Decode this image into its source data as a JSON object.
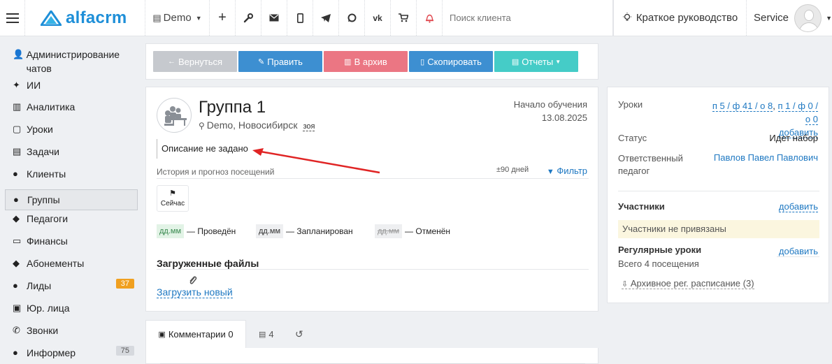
{
  "header": {
    "logo_text": "alfacrm",
    "branch": "Demo",
    "search_placeholder": "Поиск клиента",
    "guide_label": "Краткое руководство",
    "user_name": "Service",
    "icons": [
      "plus-icon",
      "wrench-icon",
      "mail-icon",
      "phone-icon",
      "telegram-icon",
      "whatsapp-icon",
      "vk-icon",
      "cart-icon",
      "bell-icon"
    ]
  },
  "sidebar": {
    "items": [
      {
        "label": "Администрирование чатов",
        "icon": "chat-admin-icon"
      },
      {
        "label": "ИИ",
        "icon": "sparkle-icon"
      },
      {
        "label": "Аналитика",
        "icon": "map-icon"
      },
      {
        "label": "Уроки",
        "icon": "calendar-icon"
      },
      {
        "label": "Задачи",
        "icon": "clipboard-icon"
      },
      {
        "label": "Клиенты",
        "icon": "user-icon"
      },
      {
        "label": "Группы",
        "icon": "users-icon"
      },
      {
        "label": "Педагоги",
        "icon": "graduation-icon"
      },
      {
        "label": "Финансы",
        "icon": "money-icon"
      },
      {
        "label": "Абонементы",
        "icon": "tag-icon"
      },
      {
        "label": "Лиды",
        "icon": "user-plus-icon",
        "badge": "37"
      },
      {
        "label": "Юр. лица",
        "icon": "briefcase-icon"
      },
      {
        "label": "Звонки",
        "icon": "phone-icon"
      },
      {
        "label": "Информер",
        "icon": "user-card-icon",
        "badge": "75"
      }
    ]
  },
  "toolbar": {
    "back": "Вернуться",
    "edit": "Править",
    "archive": "В архив",
    "copy": "Скопировать",
    "reports": "Отчеты"
  },
  "group": {
    "title": "Группа 1",
    "location": "Demo, Новосибирск",
    "tag": "зоя",
    "start_label": "Начало обучения",
    "start_date": "13.08.2025",
    "description": "Описание не задано",
    "history_label": "История и прогноз посещений",
    "history_range": "±90 дней",
    "filter": "Фильтр",
    "now_label": "Сейчас",
    "legend": [
      {
        "chip": "дд.мм",
        "label": "— Проведён"
      },
      {
        "chip": "дд.мм",
        "label": "— Запланирован"
      },
      {
        "chip": "дд.мм",
        "label": "— Отменён"
      }
    ],
    "files_title": "Загруженные файлы",
    "upload_link": "Загрузить новый"
  },
  "details": {
    "lessons_label": "Уроки",
    "lessons_line1": "п 5 / ф 41 / о 8",
    "lessons_sep": ",",
    "lessons_line1b": "п 1 / ф 0 /",
    "lessons_line2": "о 0",
    "add": "добавить",
    "status_label": "Статус",
    "status_value": "Идет набор",
    "teacher_label_1": "Ответственный",
    "teacher_label_2": "педагог",
    "teacher_value": "Павлов Павел Павлович",
    "participants_title": "Участники",
    "participants_notice": "Участники не привязаны",
    "regular_title": "Регулярные уроки",
    "regular_count": "Всего 4 посещения",
    "archive_link": "Архивное рег. расписание (3)"
  },
  "tabs": {
    "comments": "Комментарии 0",
    "tasks_count": "4"
  }
}
